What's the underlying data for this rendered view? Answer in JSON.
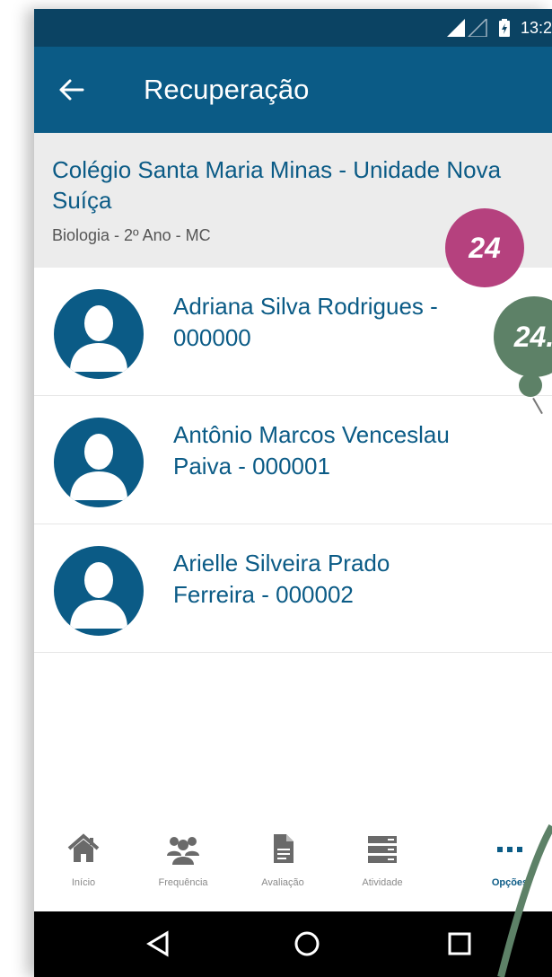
{
  "status_bar": {
    "time": "13:2"
  },
  "app_bar": {
    "title": "Recuperação"
  },
  "context": {
    "school": "Colégio Santa Maria Minas - Unidade Nova Suíça",
    "class_info": "Biologia - 2º Ano - MC"
  },
  "students": [
    {
      "name": "Adriana Silva Rodrigues - 000000"
    },
    {
      "name": "Antônio Marcos Venceslau Paiva - 000001"
    },
    {
      "name": "Arielle Silveira Prado Ferreira - 000002"
    }
  ],
  "annotations": {
    "badge_pink": "24",
    "badge_green": "24."
  },
  "bottom_nav": {
    "items": [
      {
        "label": "Início",
        "icon": "home-icon"
      },
      {
        "label": "Frequência",
        "icon": "people-icon"
      },
      {
        "label": "Avaliação",
        "icon": "document-icon"
      },
      {
        "label": "Atividade",
        "icon": "list-icon"
      },
      {
        "label": "Opções",
        "icon": "more-icon"
      }
    ]
  },
  "colors": {
    "primary": "#0b5b86",
    "status_bar": "#0b4363",
    "badge_pink": "#b5417e",
    "badge_green": "#5d8167"
  }
}
